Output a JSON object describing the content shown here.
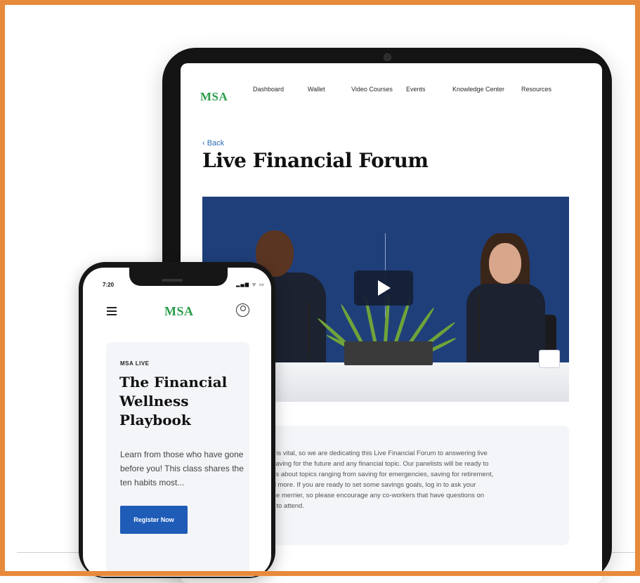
{
  "tablet": {
    "logo": "MSA",
    "nav": [
      "Dashboard",
      "Wallet",
      "Video Courses",
      "Events",
      "Knowledge Center",
      "Resources"
    ],
    "back_label": "‹ Back",
    "page_title": "Live Financial Forum",
    "video": {
      "play_icon": "play-icon"
    },
    "description_lines": [
      "ure is vital, so we are dedicating this Live Financial Forum to answering live",
      "to saving for the future and any financial topic. Our panelists will be ready to",
      "tions about topics ranging from saving for emergencies, saving for retirement,",
      "and more. If you are ready to set some savings goals, log in to ask your",
      "e the merrier, so please encourage any co-workers that have questions on",
      "ure to attend."
    ]
  },
  "phone": {
    "status_time": "7:20",
    "status_icons": "▂▄▆ ᯤ ▭",
    "logo": "MSA",
    "menu_icon": "hamburger-menu-icon",
    "account_icon": "user-account-icon",
    "eyebrow": "MSA LIVE",
    "title": "The Financial Wellness Playbook",
    "description": "Learn from those who have gone before you! This class shares the ten habits most...",
    "register_label": "Register Now"
  },
  "colors": {
    "frame_border": "#e88a3c",
    "brand_blue": "#1c3f7a",
    "brand_green": "#2a9d4a",
    "button_blue": "#1f5cb8",
    "video_backdrop": "#1f3f7a"
  }
}
